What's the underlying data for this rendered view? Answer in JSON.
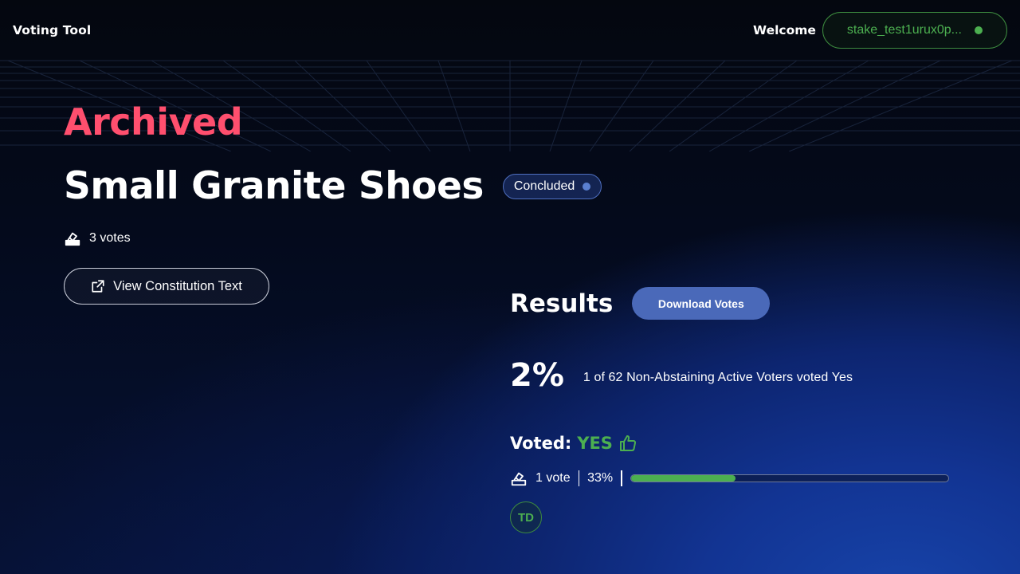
{
  "header": {
    "brand": "Voting Tool",
    "welcome": "Welcome",
    "wallet_address": "stake_test1urux0p...",
    "wallet_status_color": "#4caf50"
  },
  "page": {
    "status_heading": "Archived",
    "title": "Small Granite Shoes",
    "status_badge": "Concluded",
    "votes_count": "3 votes",
    "constitution_button": "View Constitution Text"
  },
  "results": {
    "heading": "Results",
    "download_button": "Download Votes",
    "percent": "2%",
    "description": "1 of 62 Non-Abstaining Active Voters voted Yes",
    "voted_label": "Voted:",
    "voted_value": "YES",
    "option_votes": "1 vote",
    "option_percent": "33%",
    "option_fraction": 0.33,
    "voter_initials": "TD"
  },
  "colors": {
    "archived": "#ff4f6e",
    "yes_green": "#4caf50",
    "accent_blue": "#4a69b9"
  }
}
